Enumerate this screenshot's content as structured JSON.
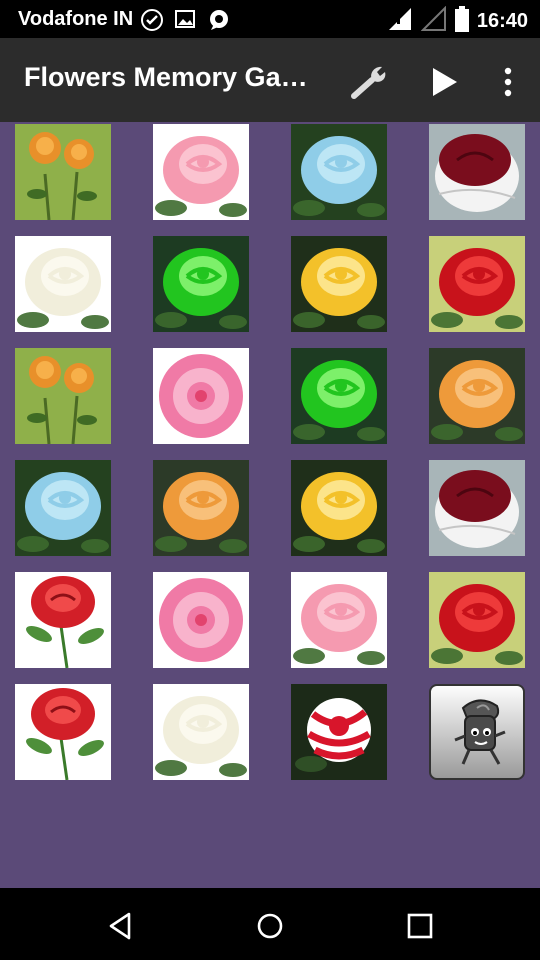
{
  "status_bar": {
    "carrier": "Vodafone IN",
    "time": "16:40",
    "icons": [
      "check-circle-icon",
      "image-icon",
      "whatsapp-icon",
      "signal-icon",
      "signal-empty-icon",
      "battery-icon"
    ]
  },
  "app_bar": {
    "title": "Flowers Memory Ga…",
    "actions": [
      "wrench-icon",
      "play-icon",
      "overflow-menu-icon"
    ]
  },
  "tiles": [
    {
      "kind": "orange-rose-bunch",
      "bg": "#8fb04a",
      "petal": "#e8902a",
      "hl": "#f7b04a"
    },
    {
      "kind": "pink-rose",
      "bg": "#ffffff",
      "petal": "#f59ab0",
      "hl": "#fbc3d0"
    },
    {
      "kind": "blue-rose",
      "bg": "#24411f",
      "petal": "#8fcde8",
      "hl": "#bde6f5"
    },
    {
      "kind": "red-white-rose",
      "bg": "#a8b5b8",
      "petal": "#7a0d1d",
      "hl": "#f3f3f3"
    },
    {
      "kind": "white-rose",
      "bg": "#ffffff",
      "petal": "#f1eedb",
      "hl": "#fbf9ee"
    },
    {
      "kind": "green-rose",
      "bg": "#1d3b22",
      "petal": "#22c51f",
      "hl": "#7df06a"
    },
    {
      "kind": "yellow-rose",
      "bg": "#1f2f1a",
      "petal": "#f3c12a",
      "hl": "#fce48a"
    },
    {
      "kind": "red-rose",
      "bg": "#c8d07a",
      "petal": "#c8121b",
      "hl": "#ee3a3a"
    },
    {
      "kind": "orange-rose-bunch",
      "bg": "#8fb04a",
      "petal": "#e8902a",
      "hl": "#f7b04a"
    },
    {
      "kind": "camellia-pink",
      "bg": "#ffffff",
      "petal": "#f07aa6",
      "hl": "#f8b3cc"
    },
    {
      "kind": "green-rose",
      "bg": "#1d3b22",
      "petal": "#22c51f",
      "hl": "#7df06a"
    },
    {
      "kind": "orange-rose",
      "bg": "#2c3a28",
      "petal": "#ee9a3a",
      "hl": "#f8c07a"
    },
    {
      "kind": "blue-rose",
      "bg": "#24411f",
      "petal": "#8fcde8",
      "hl": "#bde6f5"
    },
    {
      "kind": "orange-rose",
      "bg": "#2c3a28",
      "petal": "#ee9a3a",
      "hl": "#f8c07a"
    },
    {
      "kind": "yellow-rose",
      "bg": "#1f2f1a",
      "petal": "#f3c12a",
      "hl": "#fce48a"
    },
    {
      "kind": "red-white-rose",
      "bg": "#a8b5b8",
      "petal": "#7a0d1d",
      "hl": "#f3f3f3"
    },
    {
      "kind": "red-rose-stem",
      "bg": "#ffffff",
      "petal": "#d21f28",
      "hl": "#f04a4a"
    },
    {
      "kind": "camellia-pink",
      "bg": "#ffffff",
      "petal": "#f07aa6",
      "hl": "#f8b3cc"
    },
    {
      "kind": "pink-rose",
      "bg": "#ffffff",
      "petal": "#f59ab0",
      "hl": "#fbc3d0"
    },
    {
      "kind": "red-rose",
      "bg": "#c8d07a",
      "petal": "#c8121b",
      "hl": "#ee3a3a"
    },
    {
      "kind": "red-rose-stem",
      "bg": "#ffffff",
      "petal": "#d21f28",
      "hl": "#f04a4a"
    },
    {
      "kind": "white-rose",
      "bg": "#ffffff",
      "petal": "#f1eedb",
      "hl": "#fbf9ee"
    },
    {
      "kind": "striped-rose",
      "bg": "#1c2a18",
      "petal": "#d8152b",
      "hl": "#ffffff"
    },
    {
      "kind": "hidden-card",
      "bg": "",
      "petal": "",
      "hl": ""
    }
  ],
  "nav_bar": {
    "buttons": [
      "back-icon",
      "home-icon",
      "recents-icon"
    ]
  }
}
